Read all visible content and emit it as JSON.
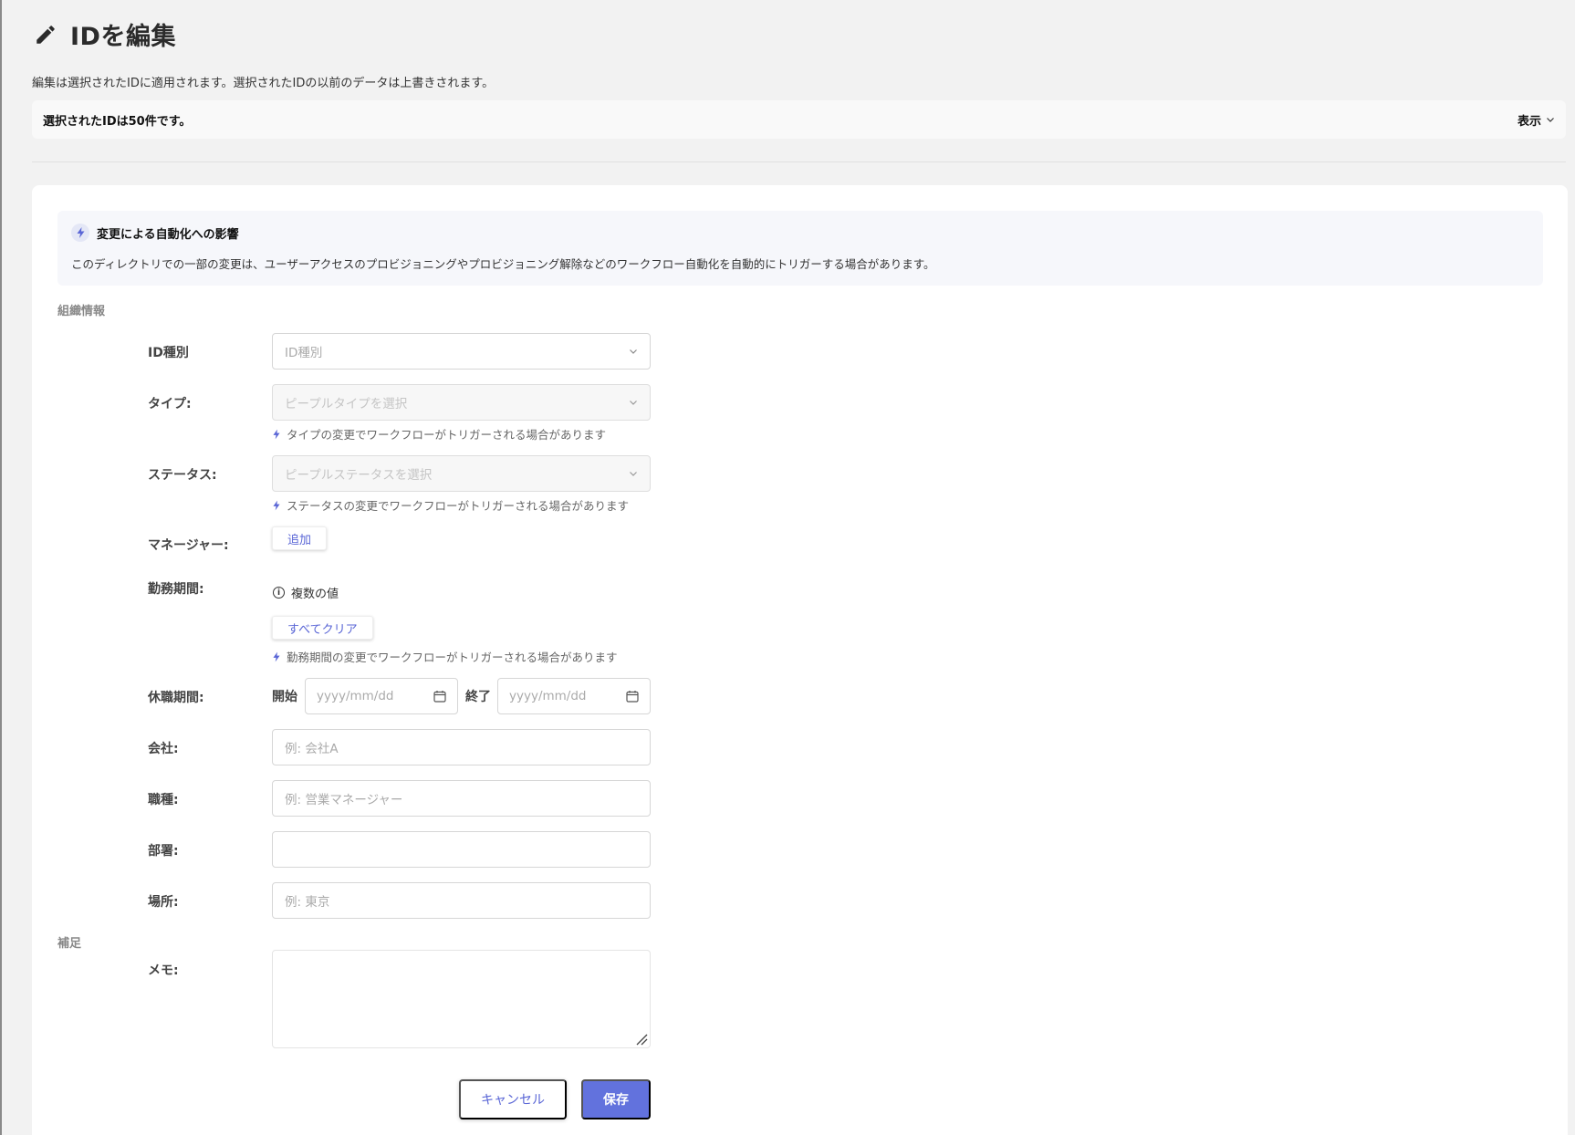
{
  "header": {
    "title": "IDを編集",
    "description": "編集は選択されたIDに適用されます。選択されたIDの以前のデータは上書きされます。"
  },
  "selection": {
    "text": "選択されたIDは50件です。",
    "toggle_label": "表示"
  },
  "notice": {
    "title": "変更による自動化への影響",
    "body": "このディレクトリでの一部の変更は、ユーザーアクセスのプロビジョニングやプロビジョニング解除などのワークフロー自動化を自動的にトリガーする場合があります。"
  },
  "sections": {
    "org": "組織情報",
    "supplement": "補足"
  },
  "fields": {
    "id_type": {
      "label": "ID種別",
      "placeholder": "ID種別"
    },
    "type": {
      "label": "タイプ:",
      "placeholder": "ピープルタイプを選択",
      "hint": "タイプの変更でワークフローがトリガーされる場合があります"
    },
    "status": {
      "label": "ステータス:",
      "placeholder": "ピープルステータスを選択",
      "hint": "ステータスの変更でワークフローがトリガーされる場合があります"
    },
    "manager": {
      "label": "マネージャー:",
      "add_label": "追加"
    },
    "employment": {
      "label": "勤務期間:",
      "info": "複数の値",
      "clear_label": "すべてクリア",
      "hint": "勤務期間の変更でワークフローがトリガーされる場合があります"
    },
    "leave": {
      "label": "休職期間:",
      "start_label": "開始",
      "end_label": "終了",
      "start_placeholder": "yyyy/mm/dd",
      "end_placeholder": "yyyy/mm/dd"
    },
    "company": {
      "label": "会社:",
      "placeholder": "例: 会社A"
    },
    "job_title": {
      "label": "職種:",
      "placeholder": "例: 営業マネージャー"
    },
    "department": {
      "label": "部署:",
      "placeholder": ""
    },
    "location": {
      "label": "場所:",
      "placeholder": "例: 東京"
    },
    "memo": {
      "label": "メモ:"
    }
  },
  "actions": {
    "cancel": "キャンセル",
    "save": "保存"
  },
  "colors": {
    "accent": "#6272dd",
    "link": "#5a66d6"
  },
  "icons": [
    "pencil-icon",
    "chevron-down-icon",
    "bolt-icon",
    "info-icon",
    "calendar-icon",
    "resize-grip-icon"
  ]
}
